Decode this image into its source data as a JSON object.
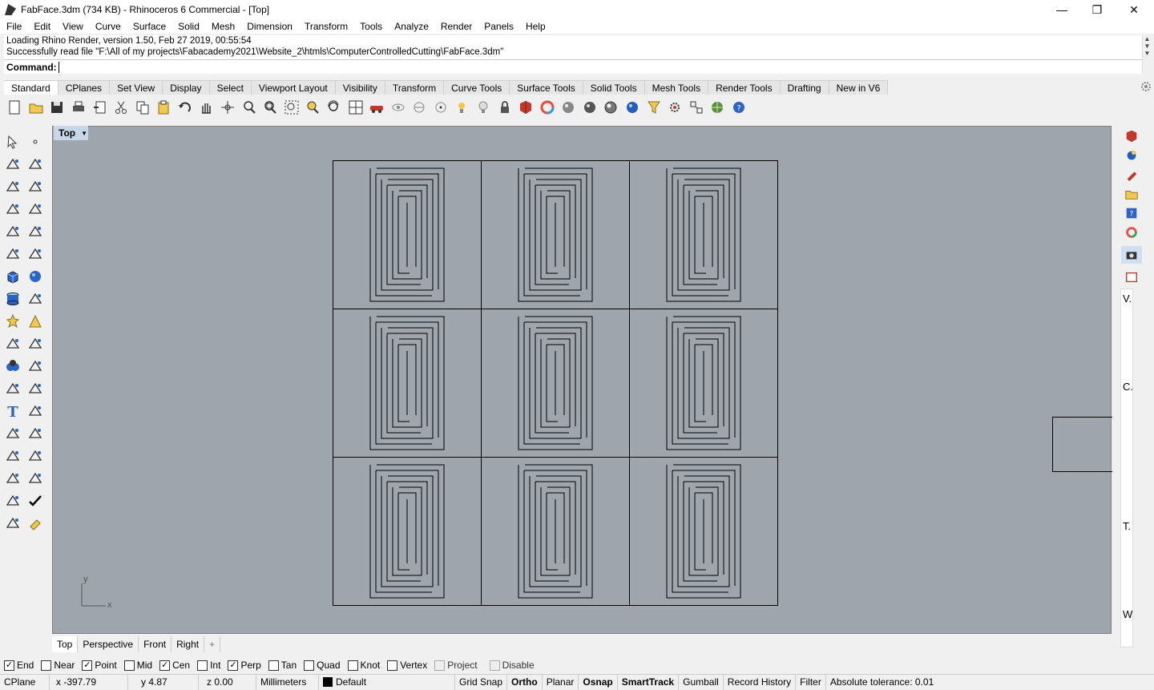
{
  "window": {
    "title": "FabFace.3dm (734 KB) - Rhinoceros 6 Commercial - [Top]",
    "minimize": "—",
    "maximize": "❐",
    "close": "✕"
  },
  "menu": [
    "File",
    "Edit",
    "View",
    "Curve",
    "Surface",
    "Solid",
    "Mesh",
    "Dimension",
    "Transform",
    "Tools",
    "Analyze",
    "Render",
    "Panels",
    "Help"
  ],
  "command": {
    "history": [
      "Loading Rhino Render, version 1.50, Feb 27 2019, 00:55:54",
      "Successfully read file \"F:\\All of my projects\\Fabacademy2021\\Website_2\\htmls\\ComputerControlledCutting\\FabFace.3dm\""
    ],
    "prompt": "Command:",
    "value": ""
  },
  "toolbar_tabs": [
    "Standard",
    "CPlanes",
    "Set View",
    "Display",
    "Select",
    "Viewport Layout",
    "Visibility",
    "Transform",
    "Curve Tools",
    "Surface Tools",
    "Solid Tools",
    "Mesh Tools",
    "Render Tools",
    "Drafting",
    "New in V6"
  ],
  "toolbar_icons": [
    "new-icon",
    "open-icon",
    "save-icon",
    "print-icon",
    "import-icon",
    "cut-icon",
    "copy-icon",
    "paste-icon",
    "undo-icon",
    "pan-hand-icon",
    "rotate-view-icon",
    "zoom-dynamic-icon",
    "zoom-window-icon",
    "zoom-extents-icon",
    "zoom-selected-icon",
    "rotate-camera-icon",
    "four-viewports-icon",
    "car-icon",
    "hide-icon",
    "show-icon",
    "snap-grid-icon",
    "light-icon",
    "bulb-icon",
    "lock-icon",
    "layer-icon",
    "color-wheel-icon",
    "material-sphere-icon",
    "render-sphere-icon",
    "shaded-sphere-icon",
    "blue-sphere-icon",
    "filter-icon",
    "settings-gear-icon",
    "snap-grid2-icon",
    "globe-icon",
    "help-icon"
  ],
  "viewport": {
    "label": "Top",
    "axis_x": "x",
    "axis_y": "y"
  },
  "view_tabs": [
    "Top",
    "Perspective",
    "Front",
    "Right"
  ],
  "view_tab_add": "+",
  "osnaps": [
    {
      "label": "End",
      "checked": true
    },
    {
      "label": "Near",
      "checked": false
    },
    {
      "label": "Point",
      "checked": true
    },
    {
      "label": "Mid",
      "checked": false
    },
    {
      "label": "Cen",
      "checked": true
    },
    {
      "label": "Int",
      "checked": false
    },
    {
      "label": "Perp",
      "checked": true
    },
    {
      "label": "Tan",
      "checked": false
    },
    {
      "label": "Quad",
      "checked": false
    },
    {
      "label": "Knot",
      "checked": false
    },
    {
      "label": "Vertex",
      "checked": false
    },
    {
      "label": "Project",
      "checked": false,
      "disabled": true
    },
    {
      "label": "Disable",
      "checked": false,
      "disabled": true
    }
  ],
  "status": {
    "cplane": "CPlane",
    "x": "x -397.79",
    "y": "y 4.87",
    "z": "z 0.00",
    "units": "Millimeters",
    "layer": "Default",
    "grid_snap": "Grid Snap",
    "ortho": "Ortho",
    "planar": "Planar",
    "osnap": "Osnap",
    "smarttrack": "SmartTrack",
    "gumball": "Gumball",
    "record_history": "Record History",
    "filter": "Filter",
    "tolerance": "Absolute tolerance: 0.01"
  },
  "right_panel_letters": [
    "V.",
    "C.",
    "T.",
    "W"
  ],
  "colors": {
    "viewport_bg": "#9ea5ad",
    "viewport_title_bg": "#c7d6e8"
  }
}
